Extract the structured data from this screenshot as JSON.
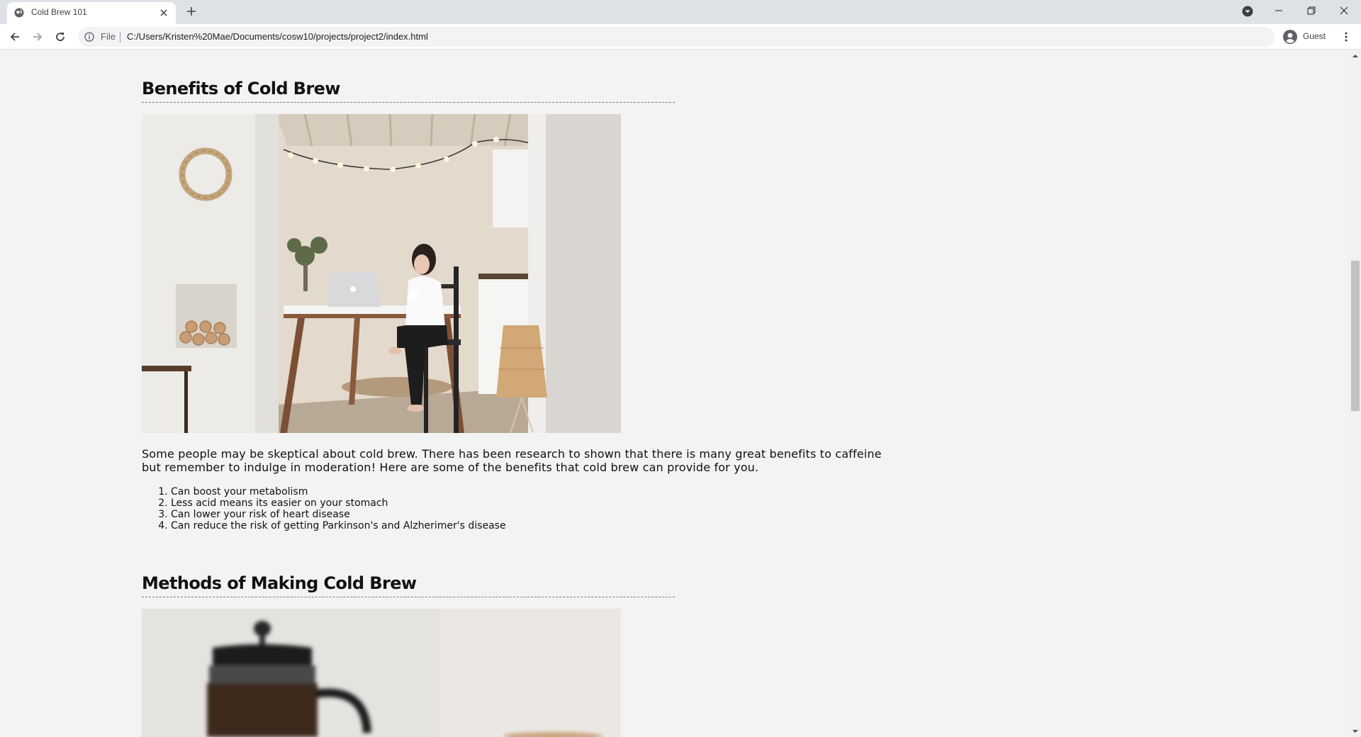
{
  "browser": {
    "tab_title": "Cold Brew 101",
    "address_scheme": "File",
    "url": "C:/Users/Kristen%20Mae/Documents/cosw10/projects/project2/index.html",
    "profile_label": "Guest"
  },
  "sections": {
    "benefits": {
      "title": "Benefits of Cold Brew",
      "paragraph": "Some people may be skeptical about cold brew. There has been research to shown that there is many great benefits to caffeine but remember to indulge in moderation! Here are some of the benefits that cold brew can provide for you.",
      "list": [
        "Can boost your metabolism",
        "Less acid means its easier on your stomach",
        "Can lower your risk of heart disease",
        "Can reduce the risk of getting Parkinson's and Alzherimer's disease"
      ]
    },
    "methods": {
      "title": "Methods of Making Cold Brew"
    }
  },
  "colors": {
    "page_background": "#f2f3f2",
    "tabstrip": "#dee1e6",
    "text": "#111111"
  }
}
